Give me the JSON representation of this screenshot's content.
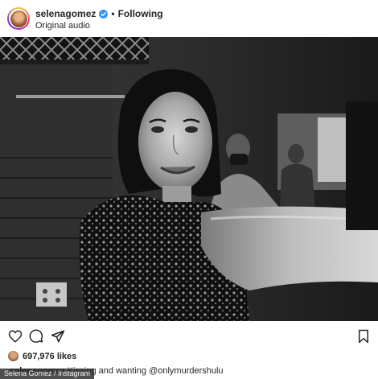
{
  "post": {
    "username": "selenagomez",
    "follow_label": "Following",
    "separator": "•",
    "audio_label": "Original audio",
    "likes": "697,976 likes",
    "caption_start": "Kissing and wanting ",
    "caption_mention": "@onlymurdershulu",
    "caption_user": "selenagomez"
  },
  "credit": "Selena Gomez / Instagram",
  "icons": {
    "like": "heart-icon",
    "comment": "comment-icon",
    "share": "send-icon",
    "save": "bookmark-icon",
    "verified": "verified-badge-icon"
  },
  "colors": {
    "verified": "#3897f0",
    "text": "#262626"
  }
}
